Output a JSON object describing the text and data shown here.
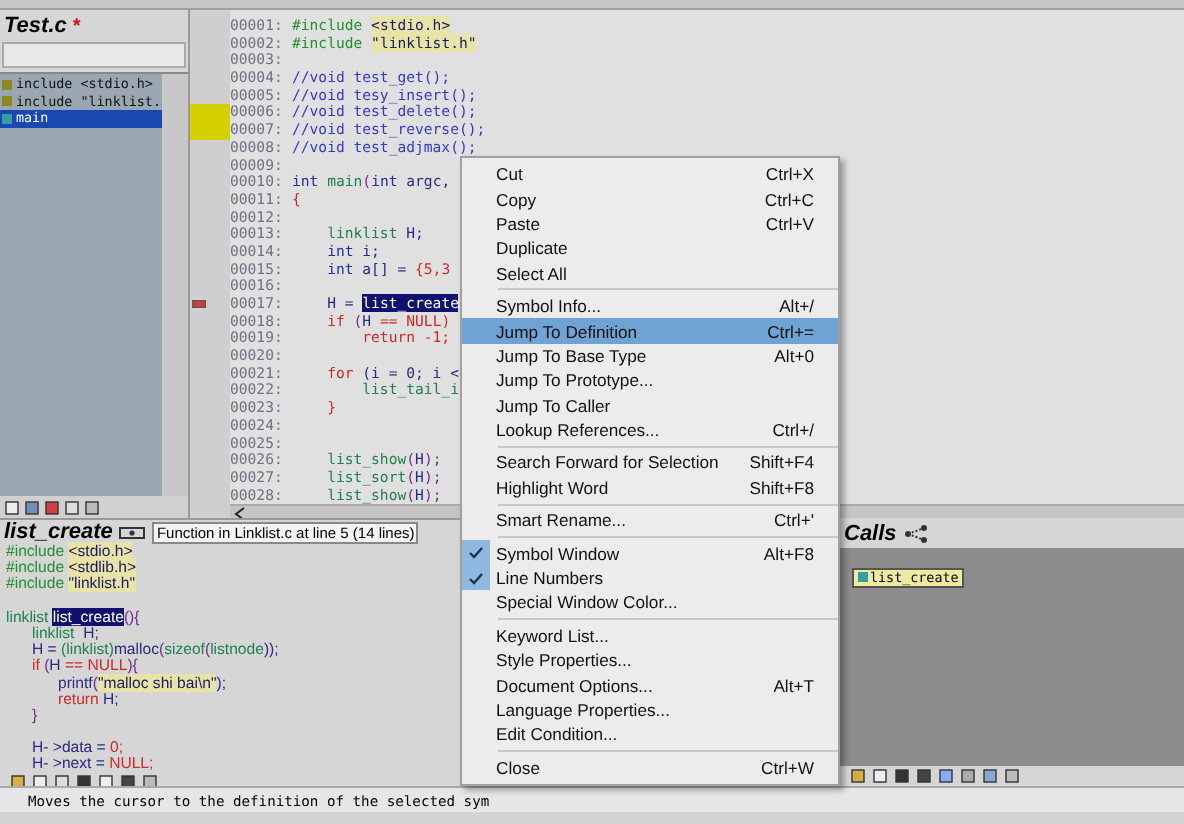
{
  "symbol_panel": {
    "title": "Test.c",
    "modified_mark": "*",
    "symbols": [
      {
        "label": "include <stdio.h>",
        "selected": false
      },
      {
        "label": "include \"linklist.",
        "selected": false
      },
      {
        "label": "main",
        "selected": true
      }
    ]
  },
  "editor": {
    "lines": [
      {
        "number": "00001:",
        "tokens": [
          {
            "text": "#include ",
            "kind": "pre"
          },
          {
            "text": "<stdio.h>",
            "kind": "str"
          }
        ]
      },
      {
        "number": "00002:",
        "tokens": [
          {
            "text": "#include ",
            "kind": "pre"
          },
          {
            "text": "\"linklist.h\"",
            "kind": "str"
          }
        ]
      },
      {
        "number": "00003:"
      },
      {
        "number": "00004:",
        "tokens": [
          {
            "text": "//void test_get();",
            "kind": "cm"
          }
        ]
      },
      {
        "number": "00005:",
        "tokens": [
          {
            "text": "//void tesy_insert();",
            "kind": "cm"
          }
        ]
      },
      {
        "number": "00006:",
        "kind": "bookmarked",
        "tokens": [
          {
            "text": "//void test_delete();",
            "kind": "cm"
          }
        ]
      },
      {
        "number": "00007:",
        "kind": "bookmarked",
        "tokens": [
          {
            "text": "//void test_reverse();",
            "kind": "cm"
          }
        ]
      },
      {
        "number": "00008:",
        "tokens": [
          {
            "text": "//void test_adjmax();",
            "kind": "cm"
          }
        ]
      },
      {
        "number": "00009:"
      },
      {
        "number": "00010:",
        "tokens": [
          {
            "text": "int ",
            "kind": "kw"
          },
          {
            "text": "main",
            "kind": "fn"
          },
          {
            "text": "(",
            "kind": "plain"
          },
          {
            "text": "int ",
            "kind": "kw"
          },
          {
            "text": "argc,",
            "kind": "id"
          }
        ]
      },
      {
        "number": "00011:",
        "tokens": [
          {
            "text": "{",
            "kind": "red"
          }
        ]
      },
      {
        "number": "00012:"
      },
      {
        "number": "00013:",
        "tokens": [
          {
            "text": "    linklist ",
            "kind": "fn"
          },
          {
            "text": "H;",
            "kind": "id"
          }
        ]
      },
      {
        "number": "00014:",
        "tokens": [
          {
            "text": "    int ",
            "kind": "kw"
          },
          {
            "text": "i;",
            "kind": "id"
          }
        ]
      },
      {
        "number": "00015:",
        "tokens": [
          {
            "text": "    int ",
            "kind": "kw"
          },
          {
            "text": "a[] = ",
            "kind": "id"
          },
          {
            "text": "{5,3",
            "kind": "red"
          }
        ]
      },
      {
        "number": "00016:"
      },
      {
        "number": "00017:",
        "kind": "marked",
        "tokens": [
          {
            "text": "    H = ",
            "kind": "id"
          },
          {
            "text": "list_create",
            "kind": "hl"
          }
        ]
      },
      {
        "number": "00018:",
        "tokens": [
          {
            "text": "    if ",
            "kind": "red"
          },
          {
            "text": "(",
            "kind": "plain"
          },
          {
            "text": "H ",
            "kind": "id"
          },
          {
            "text": "== NULL)",
            "kind": "red"
          }
        ]
      },
      {
        "number": "00019:",
        "tokens": [
          {
            "text": "        return -1;",
            "kind": "red"
          }
        ]
      },
      {
        "number": "00020:"
      },
      {
        "number": "00021:",
        "tokens": [
          {
            "text": "    for ",
            "kind": "red"
          },
          {
            "text": "(i = 0; i <",
            "kind": "id"
          }
        ]
      },
      {
        "number": "00022:",
        "tokens": [
          {
            "text": "        list_tail_i",
            "kind": "fn"
          }
        ]
      },
      {
        "number": "00023:",
        "tokens": [
          {
            "text": "    }",
            "kind": "red"
          }
        ]
      },
      {
        "number": "00024:"
      },
      {
        "number": "00025:"
      },
      {
        "number": "00026:",
        "tokens": [
          {
            "text": "    list_show",
            "kind": "fn"
          },
          {
            "text": "(",
            "kind": "plain"
          },
          {
            "text": "H",
            "kind": "id"
          },
          {
            "text": ");",
            "kind": "plain"
          }
        ]
      },
      {
        "number": "00027:",
        "tokens": [
          {
            "text": "    list_sort",
            "kind": "fn"
          },
          {
            "text": "(",
            "kind": "plain"
          },
          {
            "text": "H",
            "kind": "id"
          },
          {
            "text": ");",
            "kind": "plain"
          }
        ]
      },
      {
        "number": "00028:",
        "tokens": [
          {
            "text": "    list_show",
            "kind": "fn"
          },
          {
            "text": "(",
            "kind": "plain"
          },
          {
            "text": "H",
            "kind": "id"
          },
          {
            "text": ");",
            "kind": "plain"
          }
        ]
      }
    ]
  },
  "context_panel": {
    "title": "list_create",
    "tooltip": "Function in Linklist.c at line 5 (14 lines)",
    "lines": [
      {
        "tokens": [
          {
            "text": "#include ",
            "kind": "pre"
          },
          {
            "text": "<stdio.h>",
            "kind": "str"
          }
        ]
      },
      {
        "tokens": [
          {
            "text": "#include ",
            "kind": "pre"
          },
          {
            "text": "<stdlib.h>",
            "kind": "str"
          }
        ]
      },
      {
        "tokens": [
          {
            "text": "#include ",
            "kind": "pre"
          },
          {
            "text": "\"linklist.h\"",
            "kind": "str"
          }
        ]
      },
      {
        "kind": "blank"
      },
      {
        "tokens": [
          {
            "text": "linklist ",
            "kind": "fn"
          },
          {
            "text": "list_create",
            "kind": "hl"
          },
          {
            "text": "(){",
            "kind": "plain"
          }
        ]
      },
      {
        "tokens": [
          {
            "text": "      linklist  ",
            "kind": "fn"
          },
          {
            "text": "H;",
            "kind": "id"
          }
        ]
      },
      {
        "tokens": [
          {
            "text": "      H = ",
            "kind": "id"
          },
          {
            "text": "(linklist)",
            "kind": "fn"
          },
          {
            "text": "malloc",
            "kind": "id"
          },
          {
            "text": "(",
            "kind": "plain"
          },
          {
            "text": "sizeof",
            "kind": "fn"
          },
          {
            "text": "(",
            "kind": "plain"
          },
          {
            "text": "listnode",
            "kind": "fn"
          },
          {
            "text": "));",
            "kind": "id"
          }
        ]
      },
      {
        "tokens": [
          {
            "text": "      if ",
            "kind": "red"
          },
          {
            "text": "(",
            "kind": "plain"
          },
          {
            "text": "H ",
            "kind": "id"
          },
          {
            "text": "== NULL",
            "kind": "red"
          },
          {
            "text": "){",
            "kind": "plain"
          }
        ]
      },
      {
        "tokens": [
          {
            "text": "            printf",
            "kind": "id"
          },
          {
            "text": "(",
            "kind": "plain"
          },
          {
            "text": "\"malloc shi bai\\n\"",
            "kind": "str"
          },
          {
            "text": ");",
            "kind": "id"
          }
        ]
      },
      {
        "tokens": [
          {
            "text": "            return ",
            "kind": "red"
          },
          {
            "text": "H;",
            "kind": "id"
          }
        ]
      },
      {
        "tokens": [
          {
            "text": "      }",
            "kind": "plain"
          }
        ]
      },
      {
        "kind": "blank"
      },
      {
        "tokens": [
          {
            "text": "      H- >data = ",
            "kind": "id"
          },
          {
            "text": "0;",
            "kind": "red"
          }
        ]
      },
      {
        "tokens": [
          {
            "text": "      H- >next = ",
            "kind": "id"
          },
          {
            "text": "NULL;",
            "kind": "red"
          }
        ]
      }
    ]
  },
  "calls_panel": {
    "title": "Calls",
    "node": "list_create"
  },
  "context_menu": {
    "groups": [
      [
        {
          "label": "Cut",
          "shortcut": "Ctrl+X",
          "checked": false,
          "selected": false
        },
        {
          "label": "Copy",
          "shortcut": "Ctrl+C",
          "checked": false,
          "selected": false
        },
        {
          "label": "Paste",
          "shortcut": "Ctrl+V",
          "checked": false,
          "selected": false
        },
        {
          "label": "Duplicate",
          "checked": false,
          "selected": false
        },
        {
          "label": "Select All",
          "checked": false,
          "selected": false
        }
      ],
      [
        {
          "label": "Symbol Info...",
          "shortcut": "Alt+/",
          "checked": false,
          "selected": false
        },
        {
          "label": "Jump To Definition",
          "shortcut": "Ctrl+=",
          "checked": false,
          "selected": true
        },
        {
          "label": "Jump To Base Type",
          "shortcut": "Alt+0",
          "checked": false,
          "selected": false
        },
        {
          "label": "Jump To Prototype...",
          "checked": false,
          "selected": false
        },
        {
          "label": "Jump To Caller",
          "checked": false,
          "selected": false
        },
        {
          "label": "Lookup References...",
          "shortcut": "Ctrl+/",
          "checked": false,
          "selected": false
        }
      ],
      [
        {
          "label": "Search Forward for Selection",
          "shortcut": "Shift+F4",
          "checked": false,
          "selected": false
        },
        {
          "label": "Highlight Word",
          "shortcut": "Shift+F8",
          "checked": false,
          "selected": false
        }
      ],
      [
        {
          "label": "Smart Rename...",
          "shortcut": "Ctrl+'",
          "checked": false,
          "selected": false
        }
      ],
      [
        {
          "label": "Symbol Window",
          "shortcut": "Alt+F8",
          "checked": true,
          "selected": false
        },
        {
          "label": "Line Numbers",
          "checked": true,
          "selected": false
        },
        {
          "label": "Special Window Color...",
          "checked": false,
          "selected": false
        }
      ],
      [
        {
          "label": "Keyword List...",
          "checked": false,
          "selected": false
        },
        {
          "label": "Style Properties...",
          "checked": false,
          "selected": false
        },
        {
          "label": "Document Options...",
          "shortcut": "Alt+T",
          "checked": false,
          "selected": false
        },
        {
          "label": "Language Properties...",
          "checked": false,
          "selected": false
        },
        {
          "label": "Edit Condition...",
          "checked": false,
          "selected": false
        }
      ],
      [
        {
          "label": "Close",
          "shortcut": "Ctrl+W",
          "checked": false,
          "selected": false
        }
      ]
    ]
  },
  "status_bar": {
    "text": "Moves the cursor to the definition of the selected sym"
  }
}
